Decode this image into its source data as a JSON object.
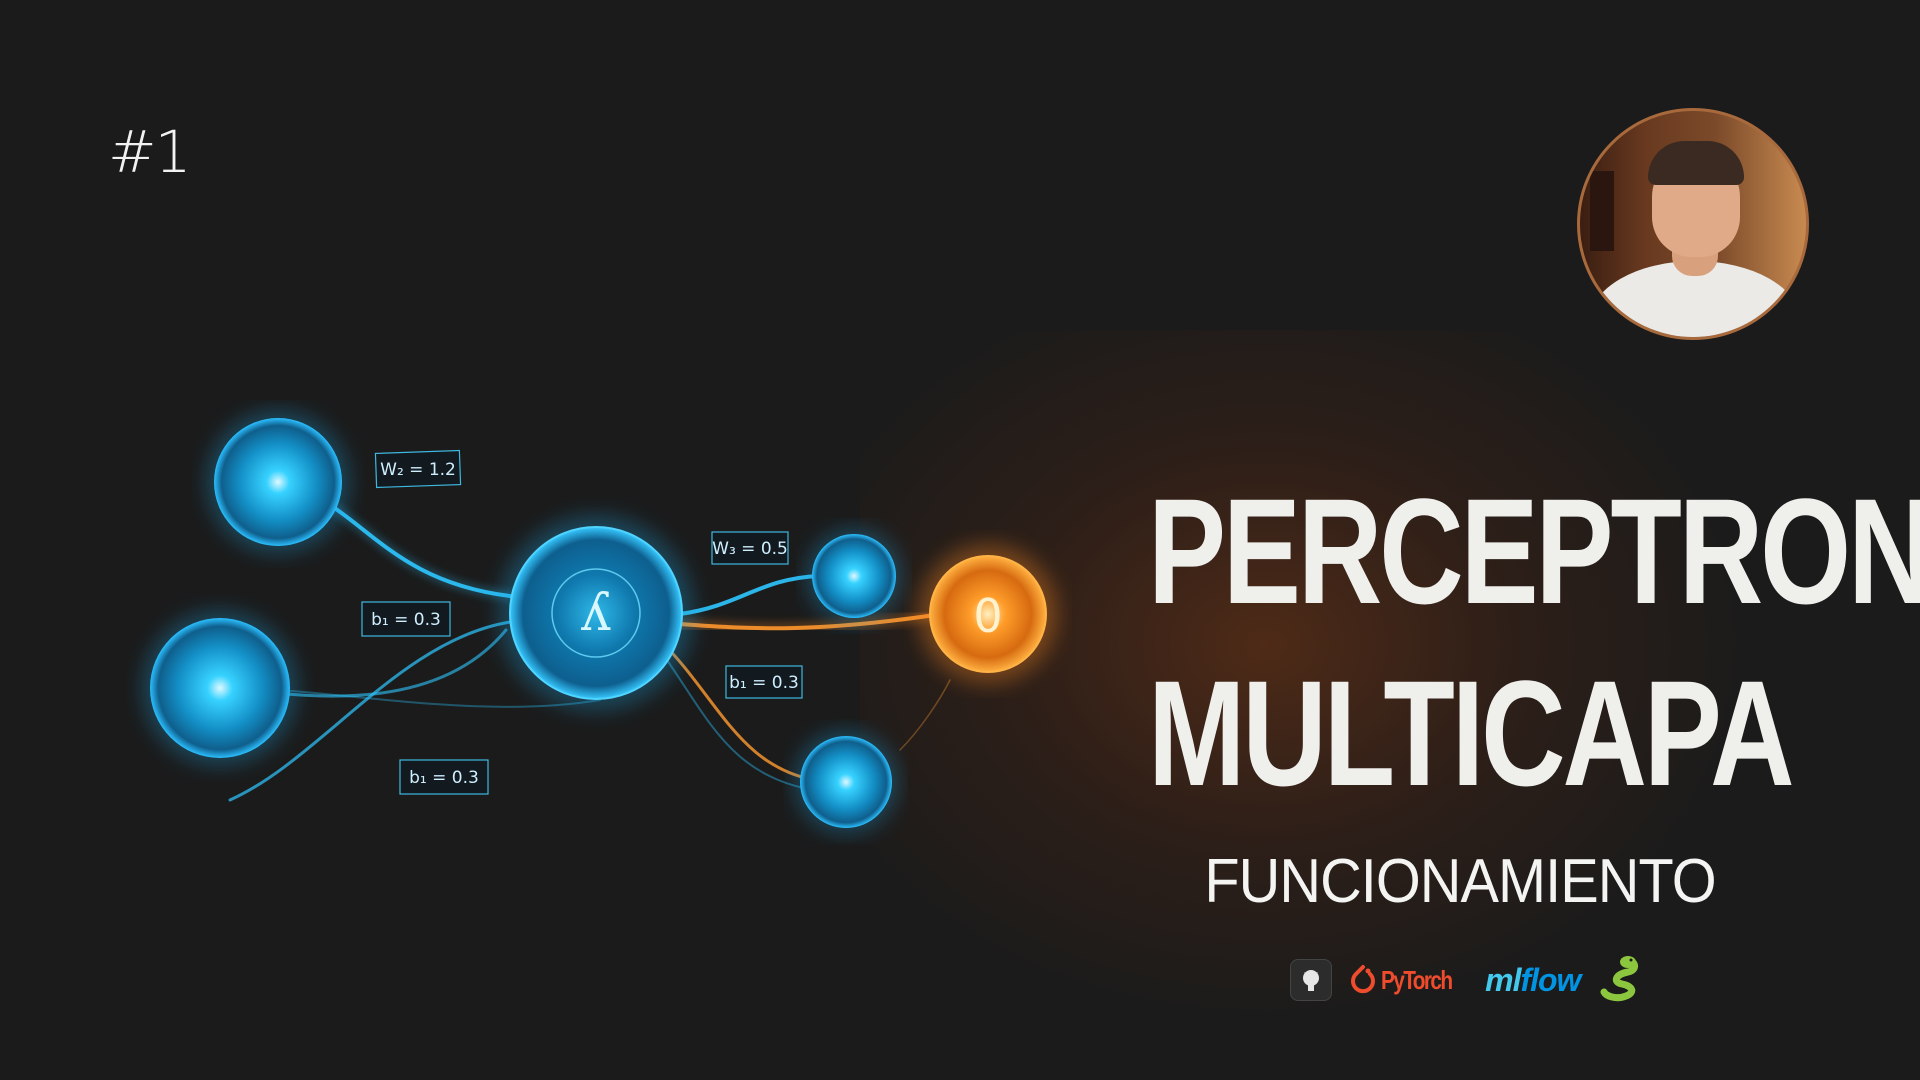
{
  "episode": "#1",
  "title_line1": "PERCEPTRON",
  "title_line2": "MULTICAPA",
  "subtitle": "FUNCIONAMIENTO",
  "network": {
    "labels": {
      "w2": "W₂ = 1.2",
      "w3": "W₃ = 0.5",
      "b1_left": "b₁ = 0.3",
      "b1_right": "b₁ = 0.3",
      "b1_bottom": "b₁ = 0.3"
    },
    "hidden_symbol": "ʎ",
    "output_symbol": "0"
  },
  "logos": {
    "pytorch": "PyTorch",
    "mlflow_ml": "ml",
    "mlflow_flow": "flow"
  },
  "colors": {
    "background": "#1b1b1b",
    "neuron_blue": "#19b8ee",
    "neuron_orange": "#f08a1c",
    "title": "#efefec",
    "avatar_border": "#a86a3c"
  },
  "icons": [
    "github-icon",
    "pytorch-icon",
    "mlflow-icon",
    "python-snake-icon"
  ]
}
